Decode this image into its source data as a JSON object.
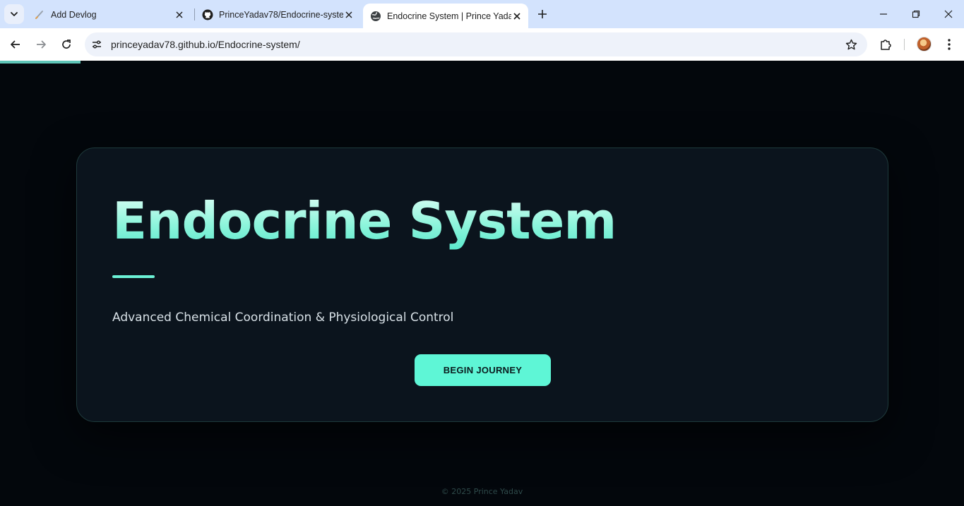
{
  "browser": {
    "tabs": [
      {
        "label": "Add Devlog",
        "icon": "devlog-favicon-icon"
      },
      {
        "label": "PrinceYadav78/Endocrine-syste",
        "icon": "github-favicon-icon"
      },
      {
        "label": "Endocrine System | Prince Yadav",
        "icon": "globe-favicon-icon",
        "active": true
      }
    ],
    "url": "princeyadav78.github.io/Endocrine-system/"
  },
  "page": {
    "title": "Endocrine System",
    "subtitle": "Advanced Chemical Coordination & Physiological Control",
    "cta_label": "BEGIN JOURNEY",
    "footer": "© 2025 Prince Yadav",
    "accent_color": "#5ef6d6",
    "background_color": "#03070c"
  }
}
